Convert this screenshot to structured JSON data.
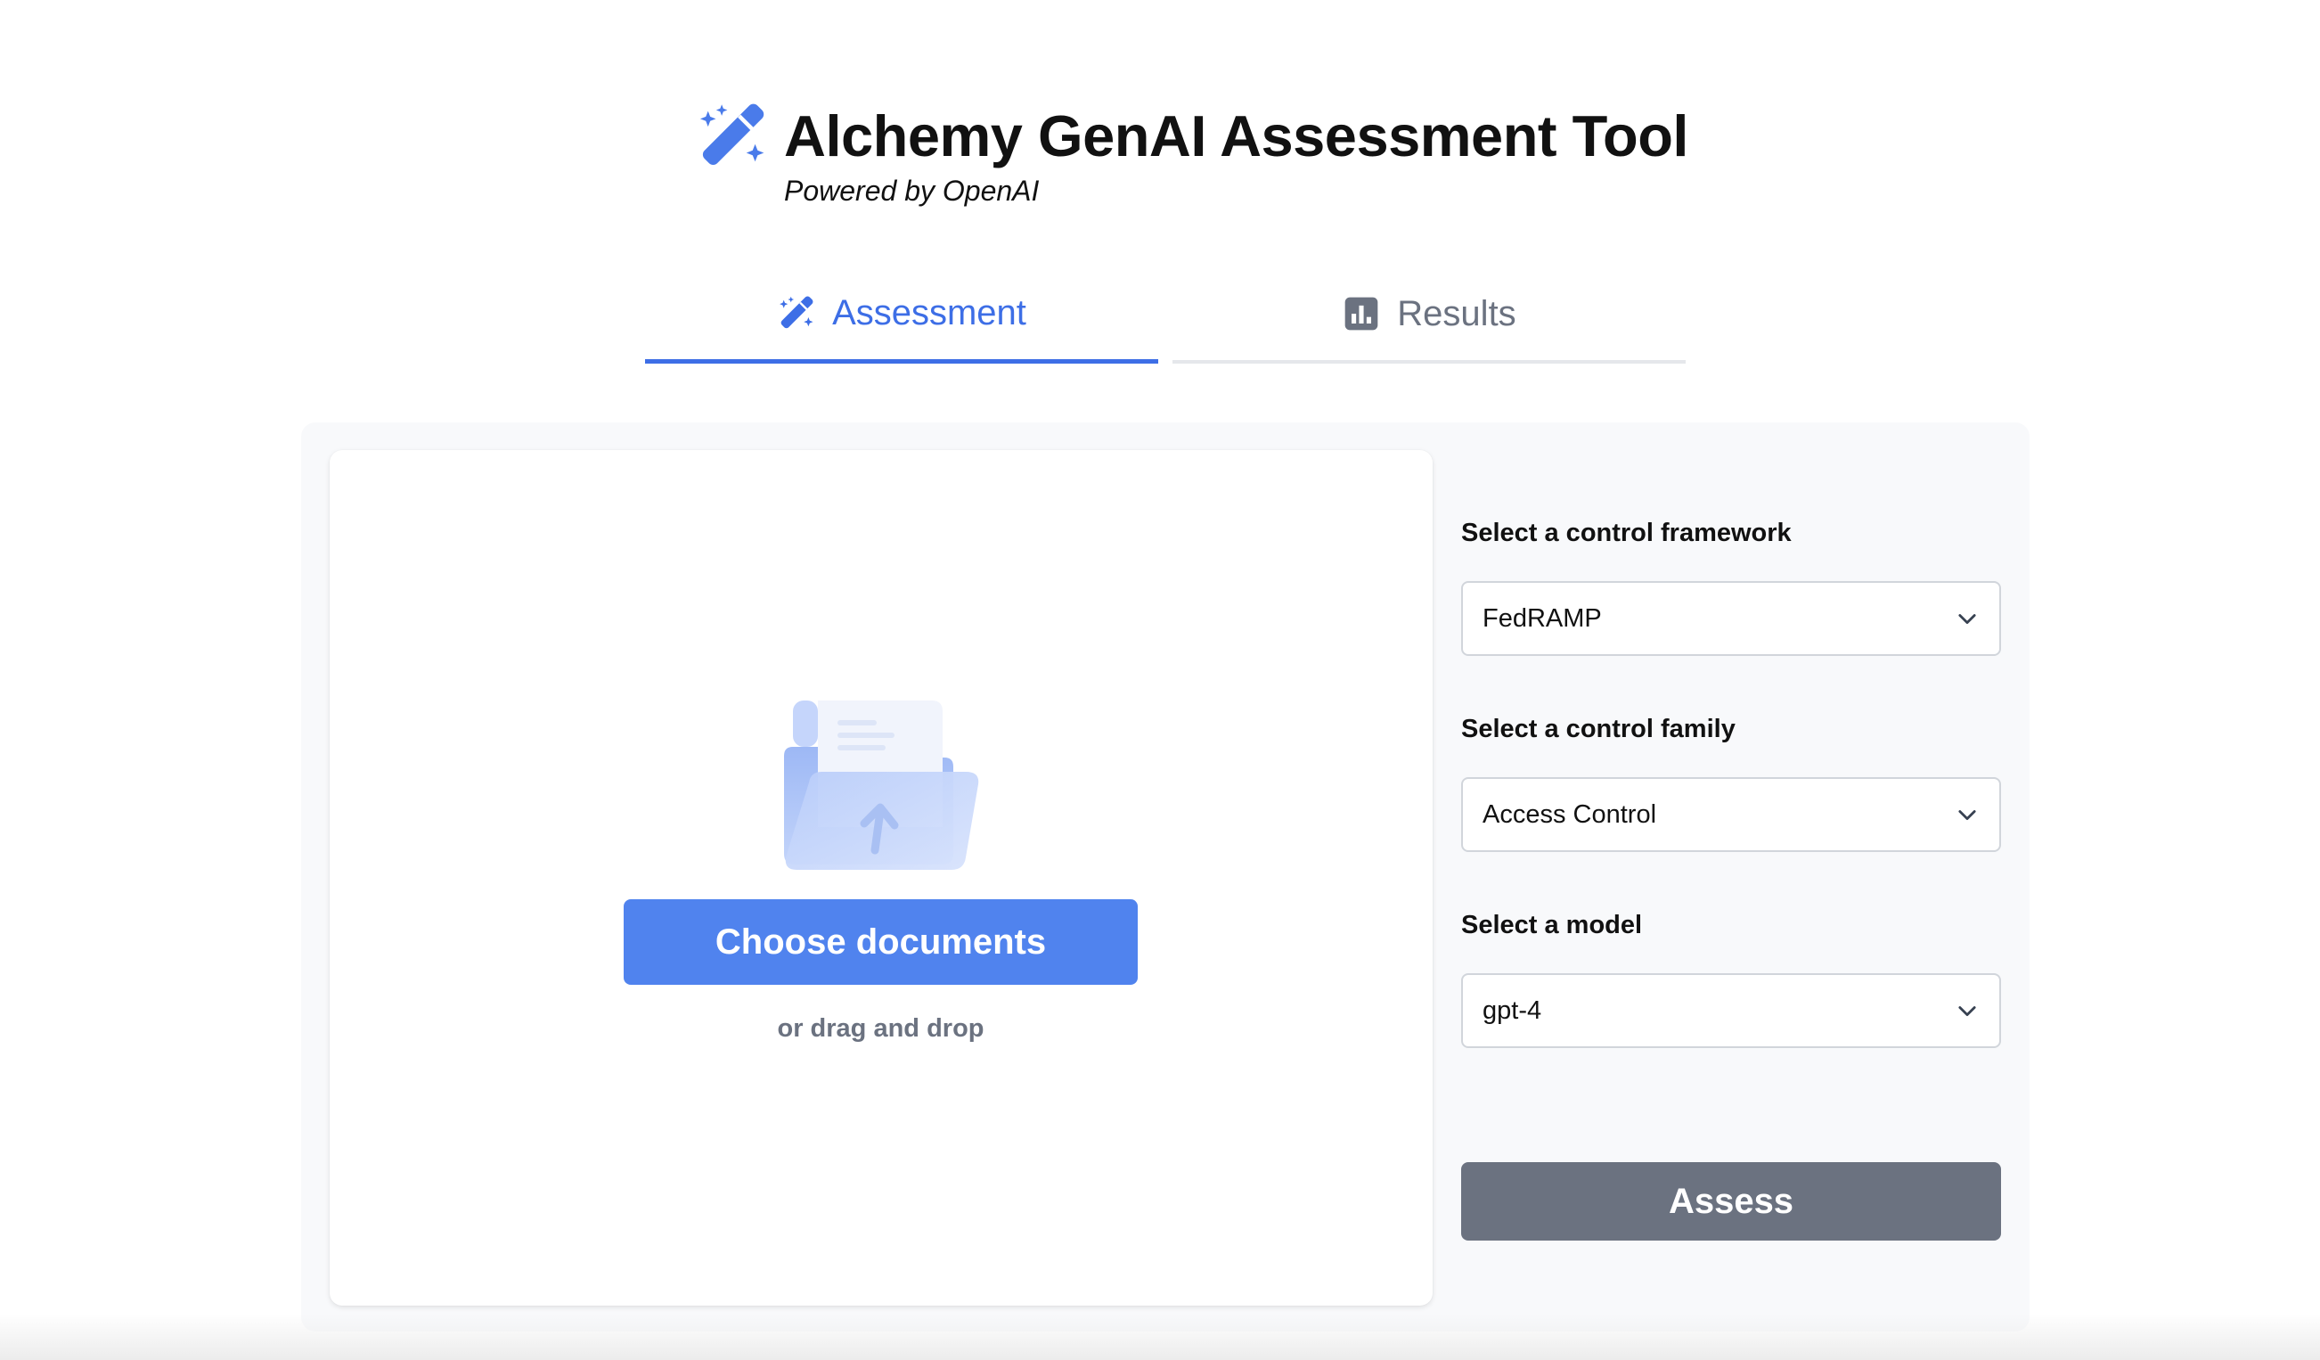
{
  "header": {
    "title": "Alchemy GenAI Assessment Tool",
    "subtitle": "Powered by OpenAI",
    "icon": "magic-wand-icon"
  },
  "tabs": [
    {
      "label": "Assessment",
      "icon": "magic-wand-icon",
      "active": true
    },
    {
      "label": "Results",
      "icon": "bar-chart-icon",
      "active": false
    }
  ],
  "upload": {
    "illustration": "folder-upload-illustration",
    "button_label": "Choose documents",
    "hint": "or drag and drop"
  },
  "form": {
    "framework": {
      "label": "Select a control framework",
      "value": "FedRAMP"
    },
    "family": {
      "label": "Select a control family",
      "value": "Access Control"
    },
    "model": {
      "label": "Select a model",
      "value": "gpt-4"
    },
    "submit_label": "Assess"
  },
  "colors": {
    "accent": "#3d6ee6",
    "primary_button": "#5083ee",
    "disabled_button": "#6b7280",
    "muted_text": "#6b7280",
    "panel_background": "#f8f9fb"
  }
}
